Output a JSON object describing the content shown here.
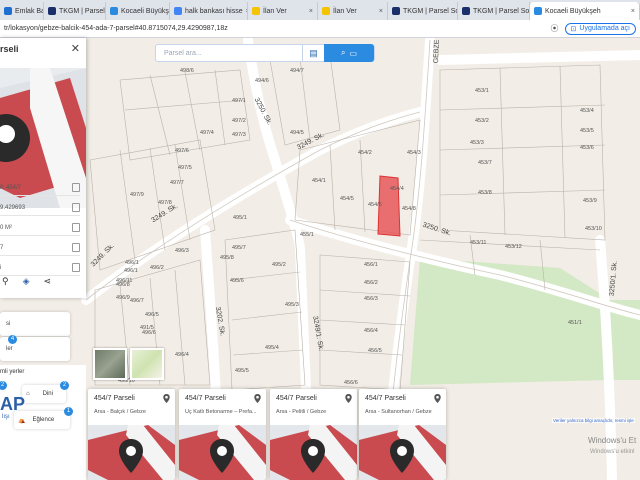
{
  "tabs": [
    {
      "label": "Emlak Banka",
      "active": false,
      "icon": "emlak-icon",
      "color": "#1f6fd1"
    },
    {
      "label": "TKGM | Parsel Sor",
      "active": false,
      "icon": "tkgm-icon",
      "color": "#1b2f6b"
    },
    {
      "label": "Kocaeli Büyükşeh",
      "active": false,
      "icon": "kocaeli-icon",
      "color": "#2a8be0"
    },
    {
      "label": "halk bankası hisse",
      "active": false,
      "icon": "google-icon",
      "color": "#4285f4"
    },
    {
      "label": "İlan Ver",
      "active": false,
      "icon": "sahibinden-icon",
      "color": "#f5c400"
    },
    {
      "label": "İlan Ver",
      "active": false,
      "icon": "sahibinden-icon",
      "color": "#f5c400"
    },
    {
      "label": "TKGM | Parsel Sor",
      "active": false,
      "icon": "tkgm-icon",
      "color": "#1b2f6b"
    },
    {
      "label": "TKGM | Parsel Sor",
      "active": false,
      "icon": "tkgm-icon",
      "color": "#1b2f6b"
    },
    {
      "label": "Kocaeli Büyükşeh",
      "active": true,
      "icon": "kocaeli-icon",
      "color": "#2a8be0"
    }
  ],
  "address": {
    "url": "tr/lokasyon/gebze-balcik-454-ada-7-parsel#40.8715074,29.4290987,18z",
    "app_pill": "Uygulamada aç",
    "pill_label": "Uygulamada açı"
  },
  "search": {
    "placeholder": "Parsel ara..."
  },
  "panel": {
    "title": "rseli",
    "rows": [
      {
        "text": "il: 454/7"
      },
      {
        "text": "9.429693"
      },
      {
        "text": "0 M²"
      },
      {
        "text": "7"
      },
      {
        "text": "i"
      }
    ]
  },
  "side_items": [
    {
      "label": "si"
    },
    {
      "label": "ler",
      "badge": "4"
    }
  ],
  "lower": {
    "title": "mli yerler",
    "cats": [
      {
        "label": "",
        "badge": "2"
      },
      {
        "label": "Dini",
        "badge": "2"
      },
      {
        "label": "Eğlence",
        "badge": "1"
      }
    ],
    "logo": "AP",
    "logo_sub": "lışı"
  },
  "cards": [
    {
      "title": "454/7 Parseli",
      "subtitle": "Arsa - Balçık / Gebze"
    },
    {
      "title": "454/7 Parseli",
      "subtitle": "Üç Katlı Betonarme – Prefa..."
    },
    {
      "title": "454/7 Parseli",
      "subtitle": "Arsa - Pelitli / Gebze"
    },
    {
      "title": "454/7 Parseli",
      "subtitle": "Arsa - Sultanorhan / Gebze"
    }
  ],
  "map_credit": "Veriler yalnızca bilgi amaçlıdır, resmi işle",
  "windows": {
    "line1": "Windows'u Et",
    "line2": "Windows'u etkinl"
  },
  "streets": [
    "3250. Sk.",
    "3249. Sk.",
    "3249. Sk.",
    "3249. Sk.",
    "3250. Sk.",
    "3250/1. Sk.",
    "3202. Sk.",
    "3249/1. Sk.",
    "GEBZE"
  ],
  "parcels": [
    "498/6",
    "494/7",
    "494/6",
    "497/1",
    "497/2",
    "497/3",
    "494/5",
    "497/4",
    "497/6",
    "497/5",
    "497/7",
    "497/8",
    "497/9",
    "495/1",
    "495/2",
    "495/3",
    "495/4",
    "495/5",
    "495/6",
    "495/7",
    "495/8",
    "496/1",
    "496/2",
    "496/3",
    "496/4",
    "496/5",
    "496/6",
    "496/7",
    "496/8",
    "496/9",
    "496/10",
    "496/11",
    "454/1",
    "454/2",
    "454/3",
    "454/4",
    "454/5",
    "454/6",
    "454/8",
    "455/1",
    "456/1",
    "456/2",
    "456/3",
    "456/4",
    "456/5",
    "456/6",
    "453/1",
    "453/2",
    "453/3",
    "453/4",
    "453/5",
    "453/6",
    "453/7",
    "453/8",
    "453/9",
    "453/10",
    "453/11",
    "453/12",
    "451/1",
    "491/5",
    "491/2",
    "496/1"
  ]
}
